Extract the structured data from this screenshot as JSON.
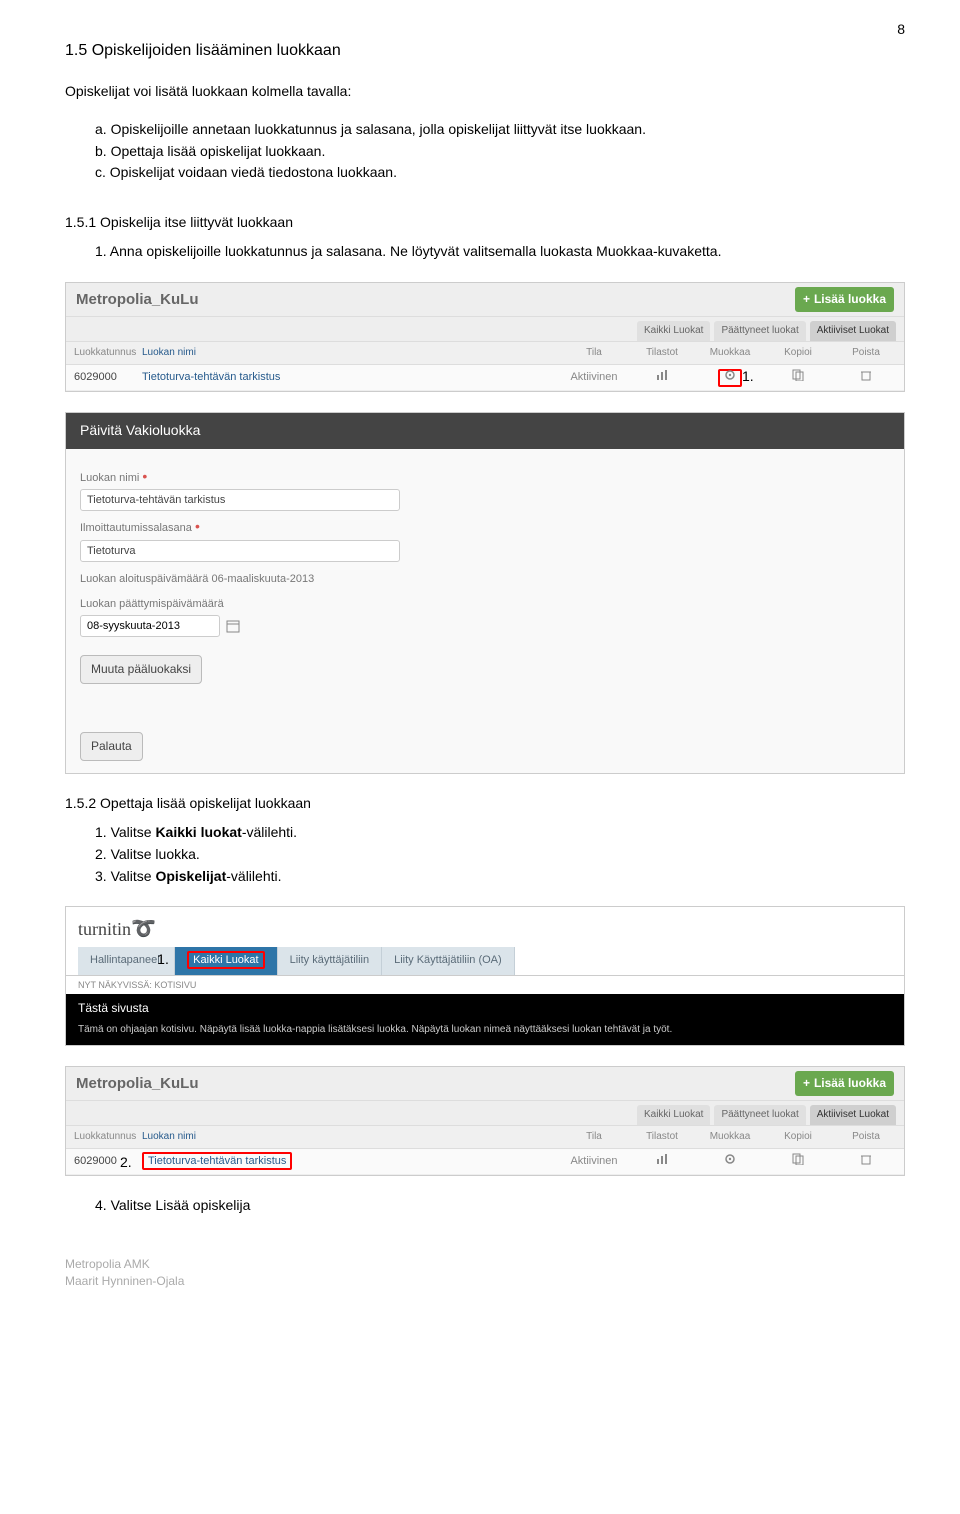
{
  "page_number": "8",
  "heading": "1.5   Opiskelijoiden lisääminen luokkaan",
  "intro": "Opiskelijat voi lisätä luokkaan kolmella tavalla:",
  "abc": {
    "a": "a.  Opiskelijoille annetaan luokkatunnus ja salasana, jolla opiskelijat liittyvät itse luokkaan.",
    "b": "b.  Opettaja lisää opiskelijat luokkaan.",
    "c": "c.  Opiskelijat voidaan viedä tiedostona luokkaan."
  },
  "sec151": {
    "title": "1.5.1   Opiskelija itse liittyvät luokkaan",
    "step1": "1.  Anna opiskelijoille luokkatunnus ja salasana. Ne löytyvät valitsemalla luokasta Muokkaa-kuvaketta."
  },
  "screenshot1": {
    "org_title": "Metropolia_KuLu",
    "add_button": "Lisää luokka",
    "tabs": {
      "all": "Kaikki Luokat",
      "ended": "Päättyneet luokat",
      "active": "Aktiiviset Luokat"
    },
    "cols": {
      "code": "Luokkatunnus",
      "name": "Luokan nimi",
      "state": "Tila",
      "stats": "Tilastot",
      "edit": "Muokkaa",
      "copy": "Kopioi",
      "delete": "Poista"
    },
    "row": {
      "code": "6029000",
      "name": "Tietoturva-tehtävän tarkistus",
      "state": "Aktiivinen"
    },
    "callout": "1."
  },
  "screenshot2": {
    "title": "Päivitä Vakioluokka",
    "l_name": "Luokan nimi",
    "v_name": "Tietoturva-tehtävän tarkistus",
    "l_pass": "Ilmoittautumissalasana",
    "v_pass": "Tietoturva",
    "start_label": "Luokan aloituspäivämäärä 06-maaliskuuta-2013",
    "end_label": "Luokan päättymispäivämäärä",
    "end_value": "08-syyskuuta-2013",
    "btn_main": "Muuta pääluokaksi",
    "btn_restore": "Palauta"
  },
  "sec152": {
    "title": "1.5.2   Opettaja lisää opiskelijat luokkaan",
    "step1_a": "1.  Valitse ",
    "step1_b": "Kaikki luokat",
    "step1_c": "-välilehti.",
    "step2": "2.  Valitse luokka.",
    "step3_a": "3.  Valitse ",
    "step3_b": "Opiskelijat",
    "step3_c": "-välilehti."
  },
  "screenshot3": {
    "logo": "turnitin",
    "tabs": {
      "panel": "Hallintapaneeli",
      "all": "Kaikki Luokat",
      "join": "Liity käyttäjätiliin",
      "join_oa": "Liity Käyttäjätiliin (OA)"
    },
    "now_viewing": "NYT NÄKYVISSÄ: KOTISIVU",
    "about_title": "Tästä sivusta",
    "about_text": "Tämä on ohjaajan kotisivu. Näpäytä lisää luokka-nappia lisätäksesi luokka. Näpäytä luokan nimeä näyttääksesi luokan tehtävät ja työt.",
    "callout1": "1.",
    "callout2": "2."
  },
  "screenshot4": {
    "org_title": "Metropolia_KuLu",
    "add_button": "Lisää luokka",
    "tabs": {
      "all": "Kaikki Luokat",
      "ended": "Päättyneet luokat",
      "active": "Aktiiviset Luokat"
    },
    "cols": {
      "code": "Luokkatunnus",
      "name": "Luokan nimi",
      "state": "Tila",
      "stats": "Tilastot",
      "edit": "Muokkaa",
      "copy": "Kopioi",
      "delete": "Poista"
    },
    "row": {
      "code": "6029000",
      "name": "Tietoturva-tehtävän tarkistus",
      "state": "Aktiivinen"
    }
  },
  "step4": "4.   Valitse Lisää opiskelija",
  "footer1": "Metropolia AMK",
  "footer2": "Maarit Hynninen-Ojala"
}
